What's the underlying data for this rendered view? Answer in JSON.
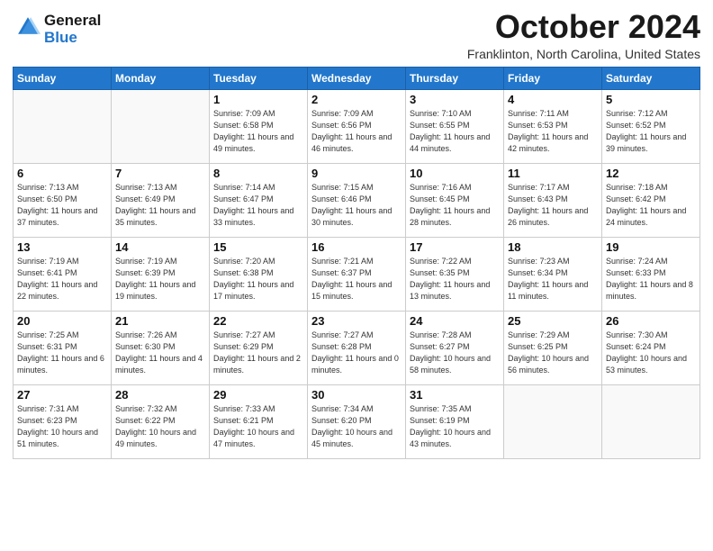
{
  "header": {
    "logo_line1": "General",
    "logo_line2": "Blue",
    "month": "October 2024",
    "location": "Franklinton, North Carolina, United States"
  },
  "days_of_week": [
    "Sunday",
    "Monday",
    "Tuesday",
    "Wednesday",
    "Thursday",
    "Friday",
    "Saturday"
  ],
  "weeks": [
    [
      {
        "day": "",
        "info": ""
      },
      {
        "day": "",
        "info": ""
      },
      {
        "day": "1",
        "info": "Sunrise: 7:09 AM\nSunset: 6:58 PM\nDaylight: 11 hours and 49 minutes."
      },
      {
        "day": "2",
        "info": "Sunrise: 7:09 AM\nSunset: 6:56 PM\nDaylight: 11 hours and 46 minutes."
      },
      {
        "day": "3",
        "info": "Sunrise: 7:10 AM\nSunset: 6:55 PM\nDaylight: 11 hours and 44 minutes."
      },
      {
        "day": "4",
        "info": "Sunrise: 7:11 AM\nSunset: 6:53 PM\nDaylight: 11 hours and 42 minutes."
      },
      {
        "day": "5",
        "info": "Sunrise: 7:12 AM\nSunset: 6:52 PM\nDaylight: 11 hours and 39 minutes."
      }
    ],
    [
      {
        "day": "6",
        "info": "Sunrise: 7:13 AM\nSunset: 6:50 PM\nDaylight: 11 hours and 37 minutes."
      },
      {
        "day": "7",
        "info": "Sunrise: 7:13 AM\nSunset: 6:49 PM\nDaylight: 11 hours and 35 minutes."
      },
      {
        "day": "8",
        "info": "Sunrise: 7:14 AM\nSunset: 6:47 PM\nDaylight: 11 hours and 33 minutes."
      },
      {
        "day": "9",
        "info": "Sunrise: 7:15 AM\nSunset: 6:46 PM\nDaylight: 11 hours and 30 minutes."
      },
      {
        "day": "10",
        "info": "Sunrise: 7:16 AM\nSunset: 6:45 PM\nDaylight: 11 hours and 28 minutes."
      },
      {
        "day": "11",
        "info": "Sunrise: 7:17 AM\nSunset: 6:43 PM\nDaylight: 11 hours and 26 minutes."
      },
      {
        "day": "12",
        "info": "Sunrise: 7:18 AM\nSunset: 6:42 PM\nDaylight: 11 hours and 24 minutes."
      }
    ],
    [
      {
        "day": "13",
        "info": "Sunrise: 7:19 AM\nSunset: 6:41 PM\nDaylight: 11 hours and 22 minutes."
      },
      {
        "day": "14",
        "info": "Sunrise: 7:19 AM\nSunset: 6:39 PM\nDaylight: 11 hours and 19 minutes."
      },
      {
        "day": "15",
        "info": "Sunrise: 7:20 AM\nSunset: 6:38 PM\nDaylight: 11 hours and 17 minutes."
      },
      {
        "day": "16",
        "info": "Sunrise: 7:21 AM\nSunset: 6:37 PM\nDaylight: 11 hours and 15 minutes."
      },
      {
        "day": "17",
        "info": "Sunrise: 7:22 AM\nSunset: 6:35 PM\nDaylight: 11 hours and 13 minutes."
      },
      {
        "day": "18",
        "info": "Sunrise: 7:23 AM\nSunset: 6:34 PM\nDaylight: 11 hours and 11 minutes."
      },
      {
        "day": "19",
        "info": "Sunrise: 7:24 AM\nSunset: 6:33 PM\nDaylight: 11 hours and 8 minutes."
      }
    ],
    [
      {
        "day": "20",
        "info": "Sunrise: 7:25 AM\nSunset: 6:31 PM\nDaylight: 11 hours and 6 minutes."
      },
      {
        "day": "21",
        "info": "Sunrise: 7:26 AM\nSunset: 6:30 PM\nDaylight: 11 hours and 4 minutes."
      },
      {
        "day": "22",
        "info": "Sunrise: 7:27 AM\nSunset: 6:29 PM\nDaylight: 11 hours and 2 minutes."
      },
      {
        "day": "23",
        "info": "Sunrise: 7:27 AM\nSunset: 6:28 PM\nDaylight: 11 hours and 0 minutes."
      },
      {
        "day": "24",
        "info": "Sunrise: 7:28 AM\nSunset: 6:27 PM\nDaylight: 10 hours and 58 minutes."
      },
      {
        "day": "25",
        "info": "Sunrise: 7:29 AM\nSunset: 6:25 PM\nDaylight: 10 hours and 56 minutes."
      },
      {
        "day": "26",
        "info": "Sunrise: 7:30 AM\nSunset: 6:24 PM\nDaylight: 10 hours and 53 minutes."
      }
    ],
    [
      {
        "day": "27",
        "info": "Sunrise: 7:31 AM\nSunset: 6:23 PM\nDaylight: 10 hours and 51 minutes."
      },
      {
        "day": "28",
        "info": "Sunrise: 7:32 AM\nSunset: 6:22 PM\nDaylight: 10 hours and 49 minutes."
      },
      {
        "day": "29",
        "info": "Sunrise: 7:33 AM\nSunset: 6:21 PM\nDaylight: 10 hours and 47 minutes."
      },
      {
        "day": "30",
        "info": "Sunrise: 7:34 AM\nSunset: 6:20 PM\nDaylight: 10 hours and 45 minutes."
      },
      {
        "day": "31",
        "info": "Sunrise: 7:35 AM\nSunset: 6:19 PM\nDaylight: 10 hours and 43 minutes."
      },
      {
        "day": "",
        "info": ""
      },
      {
        "day": "",
        "info": ""
      }
    ]
  ]
}
